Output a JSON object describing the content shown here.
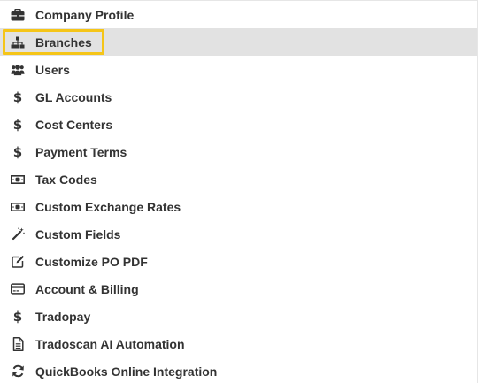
{
  "menu": {
    "items": [
      {
        "label": "Company Profile",
        "icon": "briefcase-icon"
      },
      {
        "label": "Branches",
        "icon": "sitemap-icon",
        "active": true
      },
      {
        "label": "Users",
        "icon": "users-icon"
      },
      {
        "label": "GL Accounts",
        "icon": "dollar-icon"
      },
      {
        "label": "Cost Centers",
        "icon": "dollar-icon"
      },
      {
        "label": "Payment Terms",
        "icon": "dollar-icon"
      },
      {
        "label": "Tax Codes",
        "icon": "banknote-icon"
      },
      {
        "label": "Custom Exchange Rates",
        "icon": "banknote-icon"
      },
      {
        "label": "Custom Fields",
        "icon": "magic-wand-icon"
      },
      {
        "label": "Customize PO PDF",
        "icon": "edit-icon"
      },
      {
        "label": "Account & Billing",
        "icon": "credit-card-icon"
      },
      {
        "label": "Tradopay",
        "icon": "dollar-icon"
      },
      {
        "label": "Tradoscan AI Automation",
        "icon": "document-icon"
      },
      {
        "label": "QuickBooks Online Integration",
        "icon": "sync-icon"
      }
    ]
  },
  "dollar_glyph": "$",
  "colors": {
    "active_row": "#e2e2e2",
    "highlight_border": "#f5c518",
    "text": "#333333"
  }
}
